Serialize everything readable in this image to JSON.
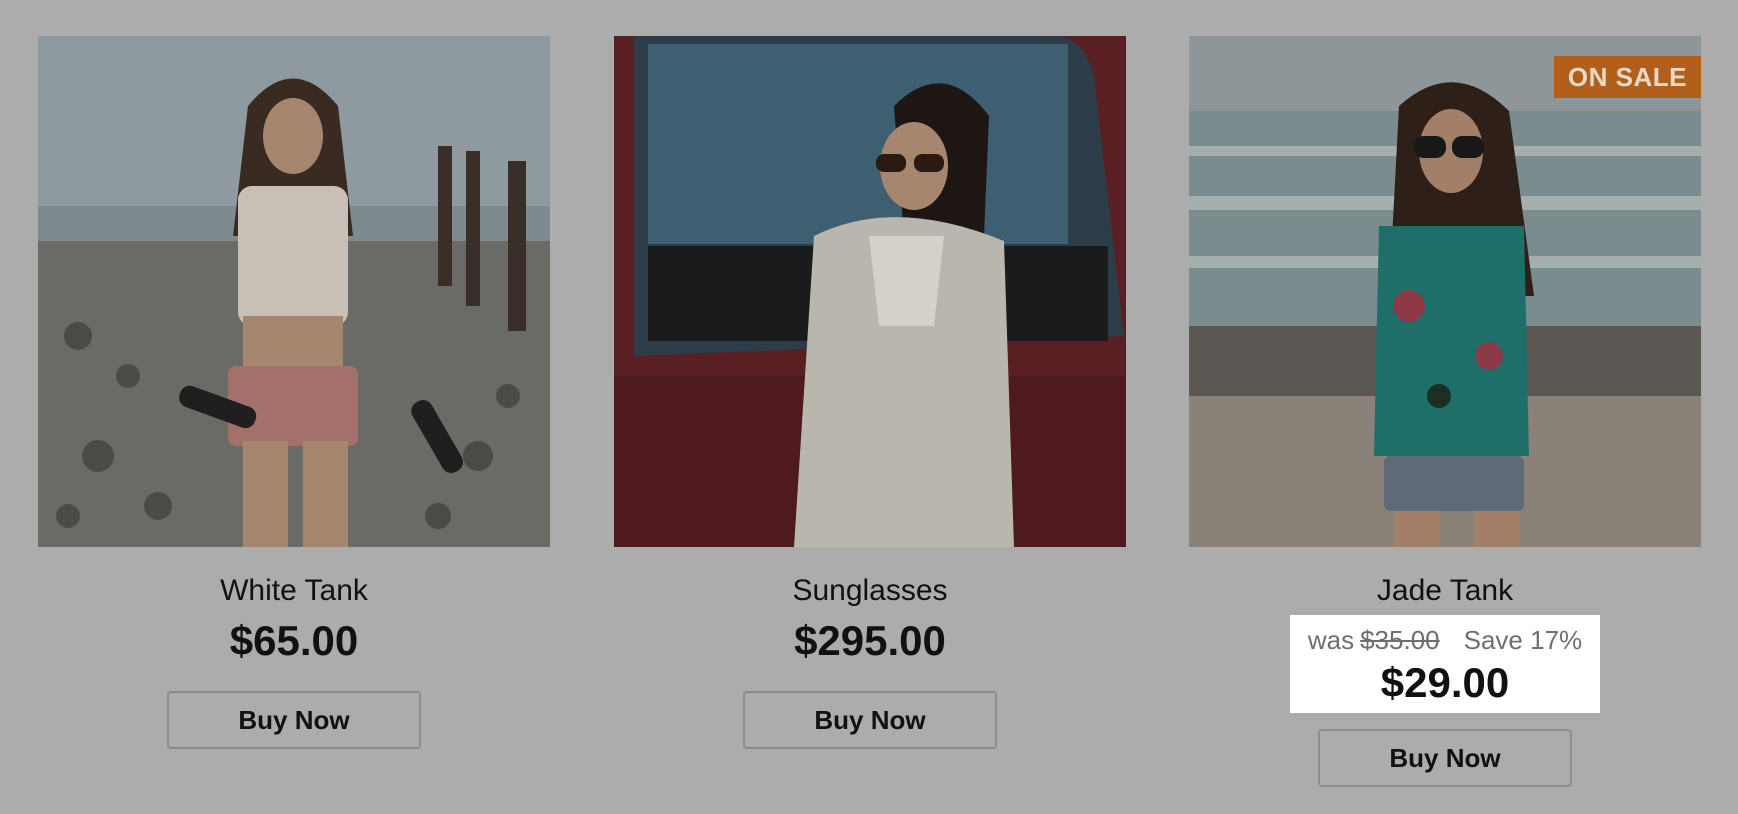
{
  "products": [
    {
      "name": "White Tank",
      "price": "$65.00",
      "button": "Buy Now"
    },
    {
      "name": "Sunglasses",
      "price": "$295.00",
      "button": "Buy Now"
    },
    {
      "name": "Jade Tank",
      "badge": "ON SALE",
      "was_label": "was",
      "was_price": "$35.00",
      "save_text": "Save 17%",
      "price": "$29.00",
      "button": "Buy Now"
    }
  ],
  "colors": {
    "page_overlay": "#acacac",
    "badge": "#b25f1b",
    "sale_box": "#ffffff"
  }
}
